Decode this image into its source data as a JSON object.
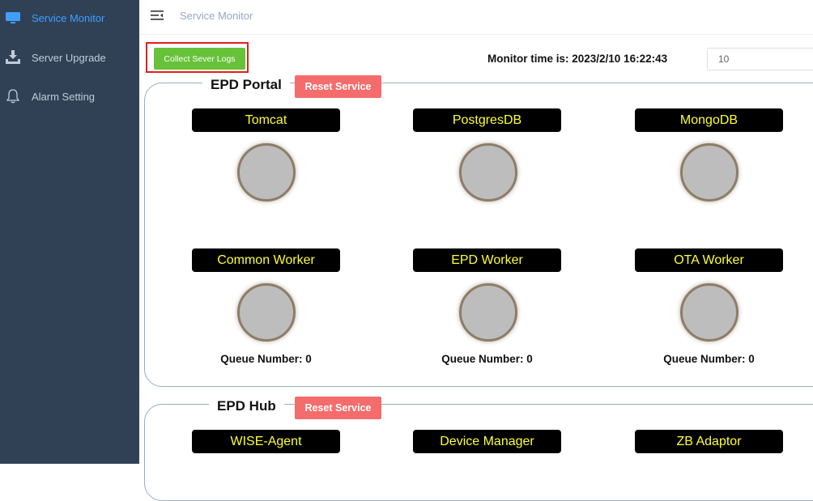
{
  "sidebar": {
    "items": [
      {
        "label": "Service Monitor",
        "icon": "monitor-icon",
        "active": true
      },
      {
        "label": "Server Upgrade",
        "icon": "download-icon",
        "active": false
      },
      {
        "label": "Alarm Setting",
        "icon": "bell-icon",
        "active": false
      }
    ]
  },
  "header": {
    "breadcrumb": "Service Monitor"
  },
  "toolbar": {
    "collect_logs_label": "Collect Sever Logs",
    "monitor_time": "Monitor time is: 2023/2/10 16:22:43",
    "refresh_value": "10"
  },
  "groups": [
    {
      "title": "EPD Portal",
      "reset_label": "Reset Service",
      "services": [
        "Tomcat",
        "PostgresDB",
        "MongoDB",
        "Common Worker",
        "EPD Worker",
        "OTA Worker"
      ],
      "queues": [
        "Queue Number: 0",
        "Queue Number: 0",
        "Queue Number: 0"
      ]
    },
    {
      "title": "EPD Hub",
      "reset_label": "Reset Service",
      "services": [
        "WISE-Agent",
        "Device Manager",
        "ZB Adaptor"
      ]
    }
  ],
  "colors": {
    "sidebar_bg": "#304156",
    "active_accent": "#409eff",
    "collect_button": "#67c23a",
    "reset_button": "#f56c6c",
    "label_text": "#ffff33",
    "status_unknown": "#bdbdbd"
  }
}
